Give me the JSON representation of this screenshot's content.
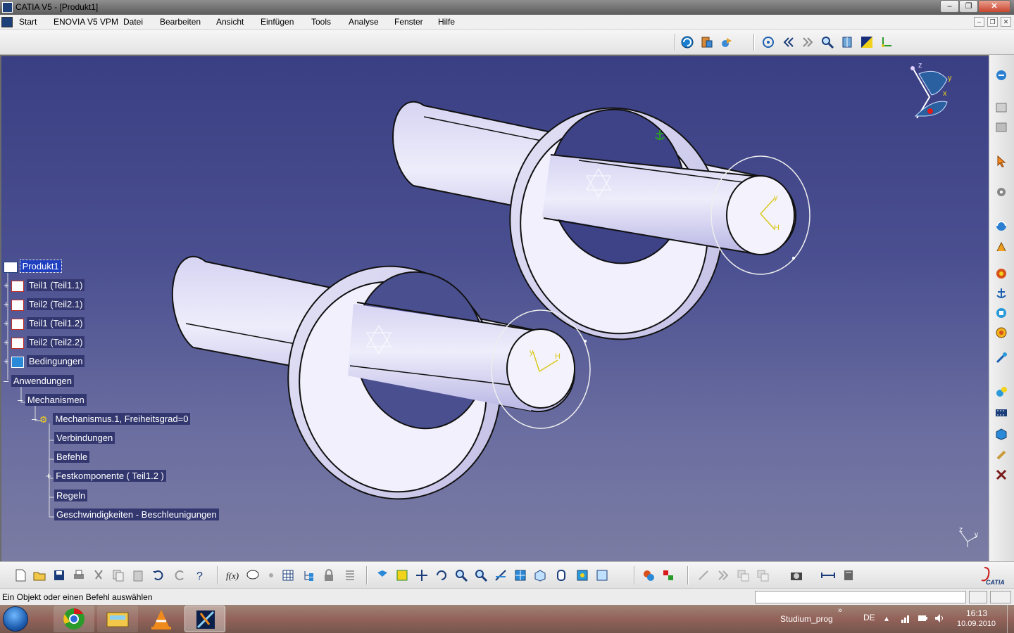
{
  "window": {
    "title": "CATIA V5 - [Produkt1]",
    "controls": [
      "–",
      "❐",
      "✕"
    ]
  },
  "menu": {
    "start": "Start",
    "items": [
      "ENOVIA V5 VPM",
      "Datei",
      "Bearbeiten",
      "Ansicht",
      "Einfügen",
      "Tools",
      "Analyse",
      "Fenster",
      "Hilfe"
    ],
    "mdi_controls": [
      "–",
      "❐",
      "✕"
    ]
  },
  "tree": {
    "root": "Produkt1",
    "nodes": [
      {
        "label": "Teil1 (Teil1.1)"
      },
      {
        "label": "Teil2 (Teil2.1)"
      },
      {
        "label": "Teil1 (Teil1.2)"
      },
      {
        "label": "Teil2 (Teil2.2)"
      },
      {
        "label": "Bedingungen"
      },
      {
        "label": "Anwendungen"
      },
      {
        "label": "Mechanismen"
      },
      {
        "label": "Mechanismus.1, Freiheitsgrad=0"
      },
      {
        "label": "Verbindungen"
      },
      {
        "label": "Befehle"
      },
      {
        "label": "Festkomponente ( Teil1.2 )"
      },
      {
        "label": "Regeln"
      },
      {
        "label": "Geschwindigkeiten - Beschleunigungen"
      }
    ]
  },
  "compass": {
    "x": "x",
    "y": "y",
    "z": "z"
  },
  "axis_labels": {
    "y": "y",
    "h": "H",
    "small_z": "z",
    "small_y": "y"
  },
  "status": {
    "message": "Ein Objekt oder einen Befehl auswählen",
    "input_value": ""
  },
  "taskbar": {
    "task_label": "Studium_prog",
    "language": "DE",
    "time": "16:13",
    "date": "10.09.2010",
    "overflow": "»"
  },
  "icons": {
    "top_toolbar": [
      "update-icon",
      "catalog-icon",
      "scene-icon",
      "fly-icon",
      "previous-icon",
      "next-icon",
      "zoom-icon",
      "normal-view-icon",
      "color-icon",
      "axis-icon"
    ],
    "right_toolbar": [
      "workbench-icon",
      "product-icon",
      "part-icon",
      "select-icon",
      "component-icon",
      "mechanism-icon",
      "joint-icon",
      "fixed-icon",
      "rigid-icon",
      "anchor-icon",
      "gear-icon",
      "sensor-icon",
      "simulate-icon",
      "analyze-icon",
      "filmstrip-icon",
      "box-icon",
      "bolt-icon",
      "tools-icon"
    ],
    "bottom_toolbar": [
      "new-icon",
      "open-icon",
      "save-icon",
      "print-icon",
      "cut-icon",
      "copy-icon",
      "paste-icon",
      "undo-icon",
      "redo-icon",
      "help-icon",
      "formula-icon",
      "comment-icon",
      "knowledge-icon",
      "table-icon",
      "tree-icon",
      "lock-icon",
      "list-icon",
      "fit-all-icon",
      "pan-icon",
      "move-icon",
      "rotate-icon",
      "zoom-in-icon",
      "zoom-out-icon",
      "normal-icon",
      "iso-view-icon",
      "cube-icon",
      "shading-icon",
      "hide-show-icon",
      "swap-icon",
      "material-icon",
      "link-icon",
      "nav-icon",
      "param-icon",
      "measure-icon",
      "camera-icon",
      "measure-between-icon",
      "wrench-icon"
    ]
  }
}
